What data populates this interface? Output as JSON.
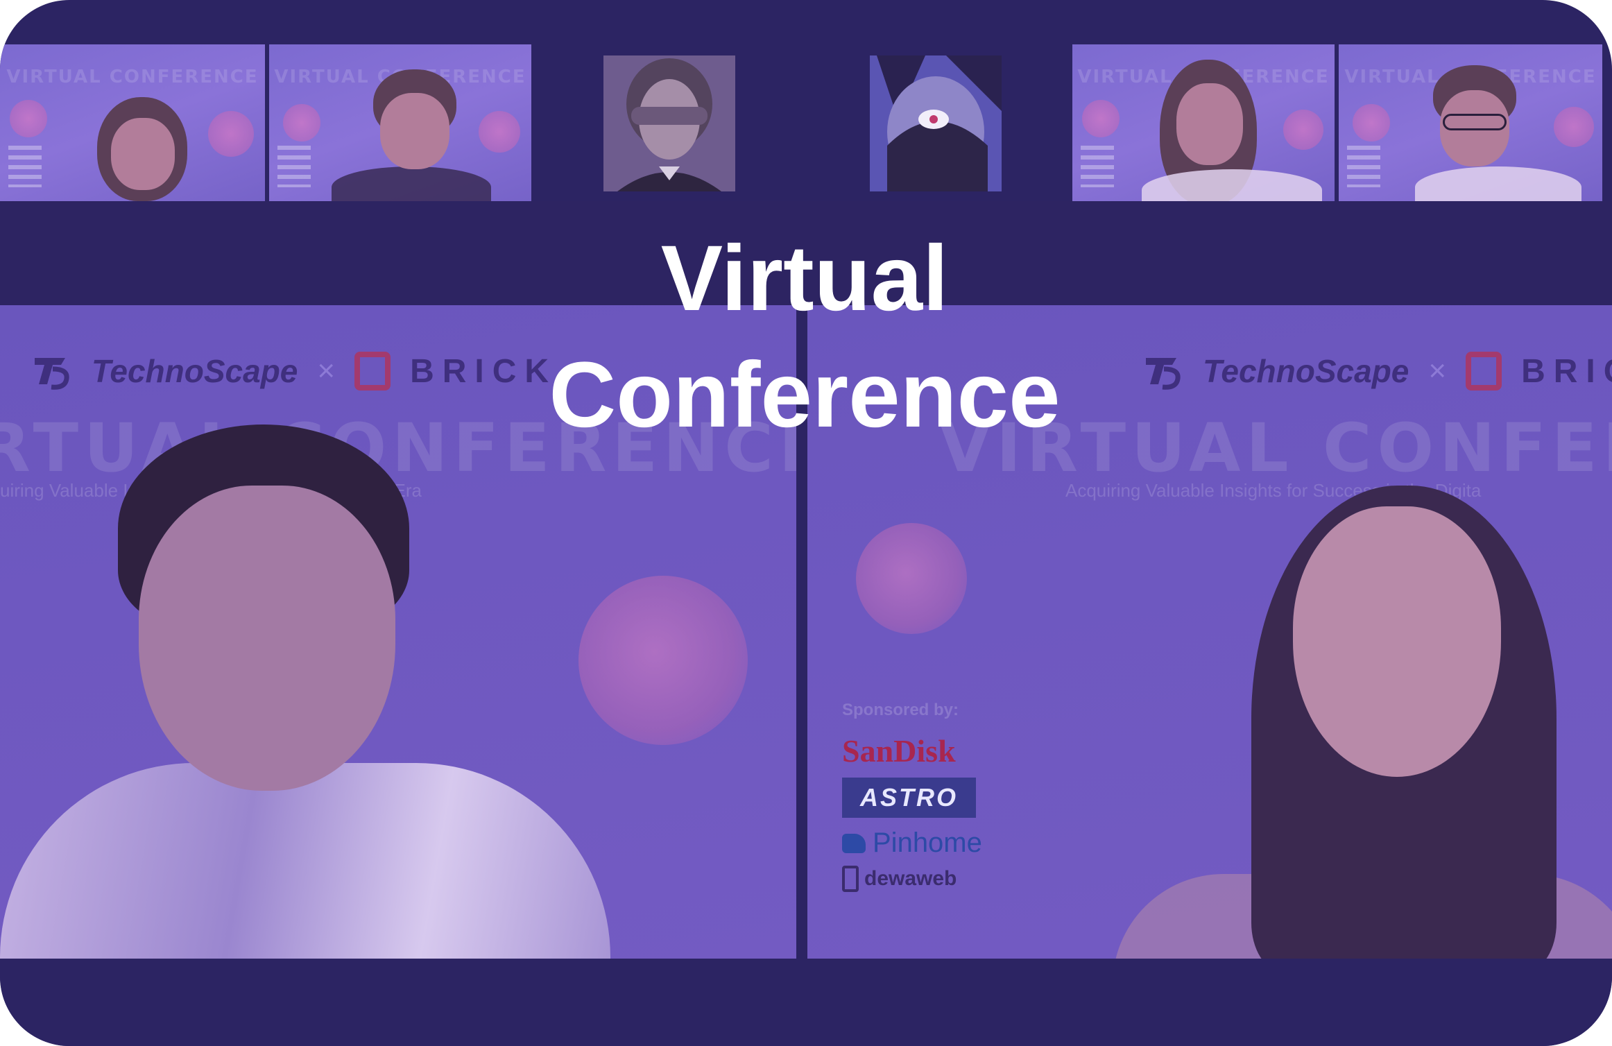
{
  "hero": {
    "title_line1": "Virtual",
    "title_line2": "Conference"
  },
  "panels": {
    "left": {
      "logo_technoscape": "TechnoScape",
      "logo_times": "×",
      "logo_brick": "BRICK",
      "bg_title": "RTUAL CONFERENCE",
      "bg_tagline": "uiring Valuable Insights for Success in the Digital Era"
    },
    "right": {
      "logo_technoscape": "TechnoScape",
      "logo_times": "×",
      "logo_brick": "BRICK",
      "bg_title": "VIRTUAL CONFERE",
      "bg_tagline": "Acquiring Valuable Insights for Success in the Digita",
      "sponsor_label": "Sponsored by:",
      "sponsors": [
        "SanDisk",
        "ASTRO",
        "Pinhome",
        "dewaweb"
      ]
    }
  },
  "thumbnails": {
    "bg_title": "VIRTUAL CONFERENCE"
  },
  "colors": {
    "frame": "#2c2463",
    "panel": "#6e58c0",
    "title_text": "#ffffff",
    "accent_pink": "#e182c4"
  }
}
